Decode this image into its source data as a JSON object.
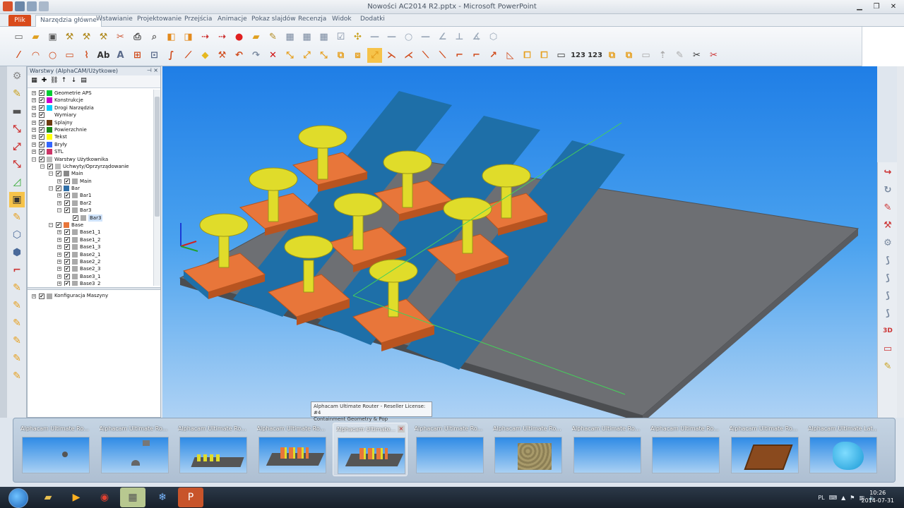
{
  "window": {
    "title": "Nowości AC2014 R2.pptx - Microsoft PowerPoint"
  },
  "ribbon_tabs": [
    {
      "label": "Plik"
    },
    {
      "label": "Narzędzia główne"
    },
    {
      "label": "Wstawianie"
    },
    {
      "label": "Projektowanie"
    },
    {
      "label": "Przejścia"
    },
    {
      "label": "Animacje"
    },
    {
      "label": "Pokaz slajdów"
    },
    {
      "label": "Recenzja"
    },
    {
      "label": "Widok"
    },
    {
      "label": "Dodatki"
    }
  ],
  "layers_panel": {
    "title": "Warstwy (AlphaCAM/Użytkowe)",
    "pin": "📌",
    "close": "×",
    "tree": [
      {
        "label": "Geometrie APS",
        "level": 0,
        "color": "#00cc33",
        "exp": "+"
      },
      {
        "label": "Konstrukcje",
        "level": 0,
        "color": "#cc00cc",
        "exp": "+"
      },
      {
        "label": "Drogi Narzędzia",
        "level": 0,
        "color": "#00ccff",
        "exp": "+"
      },
      {
        "label": "Wymiary",
        "level": 0,
        "color": "#ffffff",
        "exp": "+"
      },
      {
        "label": "Splajny",
        "level": 0,
        "color": "#6b3a10",
        "exp": "+"
      },
      {
        "label": "Powierzchnie",
        "level": 0,
        "color": "#1a8a1a",
        "exp": "+"
      },
      {
        "label": "Tekst",
        "level": 0,
        "color": "#ffff00",
        "exp": "+"
      },
      {
        "label": "Bryły",
        "level": 0,
        "color": "#3366ff",
        "exp": "+"
      },
      {
        "label": "STL",
        "level": 0,
        "color": "#cc3366",
        "exp": "+"
      },
      {
        "label": "Warstwy Użytkownika",
        "level": 0,
        "color": "#bbbbbb",
        "exp": "−"
      },
      {
        "label": "Uchwyty/Oprzyrządowanie",
        "level": 1,
        "color": "#bbbbbb",
        "exp": "−"
      },
      {
        "label": "Main",
        "level": 2,
        "color": "#888888",
        "exp": "−"
      },
      {
        "label": "Main",
        "level": 3,
        "color": "#aaaaaa",
        "exp": "+"
      },
      {
        "label": "Bar",
        "level": 2,
        "color": "#2f6fa8",
        "exp": "−"
      },
      {
        "label": "Bar1",
        "level": 3,
        "color": "#aaaaaa",
        "exp": "+"
      },
      {
        "label": "Bar2",
        "level": 3,
        "color": "#aaaaaa",
        "exp": "+"
      },
      {
        "label": "Bar3",
        "level": 3,
        "color": "#aaaaaa",
        "exp": "−"
      },
      {
        "label": "Bar3",
        "level": 4,
        "color": "#aaaaaa",
        "exp": "",
        "selected": true
      },
      {
        "label": "Base",
        "level": 2,
        "color": "#e8763a",
        "exp": "−"
      },
      {
        "label": "Base1_1",
        "level": 3,
        "color": "#aaaaaa",
        "exp": "+"
      },
      {
        "label": "Base1_2",
        "level": 3,
        "color": "#aaaaaa",
        "exp": "+"
      },
      {
        "label": "Base1_3",
        "level": 3,
        "color": "#aaaaaa",
        "exp": "+"
      },
      {
        "label": "Base2_1",
        "level": 3,
        "color": "#aaaaaa",
        "exp": "+"
      },
      {
        "label": "Base2_2",
        "level": 3,
        "color": "#aaaaaa",
        "exp": "+"
      },
      {
        "label": "Base2_3",
        "level": 3,
        "color": "#aaaaaa",
        "exp": "+"
      },
      {
        "label": "Base3_1",
        "level": 3,
        "color": "#aaaaaa",
        "exp": "+"
      },
      {
        "label": "Base3_2",
        "level": 3,
        "color": "#aaaaaa",
        "exp": "+"
      }
    ],
    "machine_config": "Konfiguracja Maszyny"
  },
  "tooltip": {
    "line1": "Alphacam Ultimate Router - Reseller License: #4",
    "line2": "Containment Geometry & Pop"
  },
  "thumbnails": [
    {
      "title": "Alphacam Ultimate Ro...",
      "kind": "blank-dot"
    },
    {
      "title": "Alphacam Ultimate Ro...",
      "kind": "blank-dome"
    },
    {
      "title": "Alphacam Ultimate Ro...",
      "kind": "plate-yellow"
    },
    {
      "title": "Alphacam Ultimate Ro...",
      "kind": "fixture"
    },
    {
      "title": "Alphacam Ultimate...",
      "kind": "fixture",
      "selected": true,
      "close": "×"
    },
    {
      "title": "Alphacam Ultimate Ro...",
      "kind": "blank"
    },
    {
      "title": "Alphacam Ultimate Ro...",
      "kind": "texture"
    },
    {
      "title": "Alphacam Ultimate Ro...",
      "kind": "blank"
    },
    {
      "title": "Alphacam Ultimate Ro...",
      "kind": "blank"
    },
    {
      "title": "Alphacam Ultimate Ro...",
      "kind": "brown-plate"
    },
    {
      "title": "Alphacam Ultimate Lat...",
      "kind": "lathe-part"
    }
  ],
  "tray": {
    "lang": "PL",
    "time": "10:26",
    "date": "2014-07-31"
  },
  "colors": {
    "file_tab": "#d94b1c",
    "viewport_top": "#1f7ee6",
    "viewport_bottom": "#aed2f4",
    "base_orange": "#e8763a",
    "bar_blue": "#1e6fa8",
    "pin_yellow": "#e0dc2a",
    "plate_gray": "#6d6f73"
  }
}
